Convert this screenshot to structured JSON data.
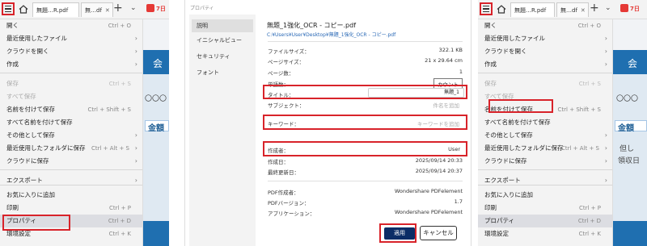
{
  "tabs": {
    "tab1_label": "無題…R.pdf",
    "tab2_label": "無…df",
    "close_glyph": "✕",
    "new_tab_glyph": "+",
    "more_glyph": "⌄",
    "promo_label": "7日"
  },
  "menu_left": [
    {
      "label": "開く",
      "shortcut": "Ctrl + O",
      "submenu": "",
      "disabled": false
    },
    {
      "label": "最近使用したファイル",
      "shortcut": "",
      "submenu": "›",
      "disabled": false
    },
    {
      "label": "クラウドを開く",
      "shortcut": "",
      "submenu": "›",
      "disabled": false
    },
    {
      "label": "作成",
      "shortcut": "",
      "submenu": "›",
      "disabled": false
    },
    {
      "label": "保存",
      "shortcut": "Ctrl + S",
      "submenu": "",
      "disabled": true
    },
    {
      "label": "すべて保存",
      "shortcut": "",
      "submenu": "",
      "disabled": true
    },
    {
      "label": "名前を付けて保存",
      "shortcut": "Ctrl + Shift + S",
      "submenu": "",
      "disabled": false
    },
    {
      "label": "すべて名前を付けて保存",
      "shortcut": "",
      "submenu": "",
      "disabled": false
    },
    {
      "label": "その他として保存",
      "shortcut": "",
      "submenu": "›",
      "disabled": false
    },
    {
      "label": "最近使用したフォルダに保存",
      "shortcut": "Ctrl + Alt + S",
      "submenu": "›",
      "disabled": false
    },
    {
      "label": "クラウドに保存",
      "shortcut": "",
      "submenu": "›",
      "disabled": false
    },
    {
      "label": "エクスポート",
      "shortcut": "",
      "submenu": "›",
      "disabled": false
    },
    {
      "label": "お気に入りに追加",
      "shortcut": "",
      "submenu": "",
      "disabled": false
    },
    {
      "label": "印刷",
      "shortcut": "Ctrl + P",
      "submenu": "",
      "disabled": false
    },
    {
      "label": "プロパティ",
      "shortcut": "Ctrl + D",
      "submenu": "",
      "disabled": false
    },
    {
      "label": "環境設定",
      "shortcut": "Ctrl + K",
      "submenu": "",
      "disabled": false
    }
  ],
  "menu_right": [
    {
      "label": "開く",
      "shortcut": "Ctrl + O",
      "submenu": "",
      "disabled": false
    },
    {
      "label": "最近使用したファイル",
      "shortcut": "",
      "submenu": "›",
      "disabled": false
    },
    {
      "label": "クラウドを開く",
      "shortcut": "",
      "submenu": "›",
      "disabled": false
    },
    {
      "label": "作成",
      "shortcut": "",
      "submenu": "›",
      "disabled": false
    },
    {
      "label": "保存",
      "shortcut": "Ctrl + S",
      "submenu": "",
      "disabled": true
    },
    {
      "label": "すべて保存",
      "shortcut": "",
      "submenu": "",
      "disabled": true
    },
    {
      "label": "名前を付けて保存",
      "shortcut": "Ctrl + Shift + S",
      "submenu": "",
      "disabled": false
    },
    {
      "label": "すべて名前を付けて保存",
      "shortcut": "",
      "submenu": "",
      "disabled": false
    },
    {
      "label": "その他として保存",
      "shortcut": "",
      "submenu": "›",
      "disabled": false
    },
    {
      "label": "最近使用したフォルダに保存",
      "shortcut": "Ctrl + Alt + S",
      "submenu": "›",
      "disabled": false
    },
    {
      "label": "クラウドに保存",
      "shortcut": "",
      "submenu": "›",
      "disabled": false
    },
    {
      "label": "エクスポート",
      "shortcut": "",
      "submenu": "›",
      "disabled": false
    },
    {
      "label": "お気に入りに追加",
      "shortcut": "",
      "submenu": "",
      "disabled": false
    },
    {
      "label": "印刷",
      "shortcut": "Ctrl + P",
      "submenu": "",
      "disabled": false
    },
    {
      "label": "プロパティ",
      "shortcut": "Ctrl + D",
      "submenu": "",
      "disabled": false
    },
    {
      "label": "環境設定",
      "shortcut": "Ctrl + K",
      "submenu": "",
      "disabled": false
    }
  ],
  "background_doc": {
    "right_header": "会",
    "left_header": "会",
    "circles": "〇〇〇",
    "amount_label": "金額",
    "note1": "但し",
    "note2": "領収日"
  },
  "dialog": {
    "title": "プロパティ",
    "sidebar": [
      "説明",
      "イニシャルビュー",
      "セキュリティ",
      "フォント"
    ],
    "file_name": "無題_1強化_OCR - コピー.pdf",
    "file_path": "C:¥Users¥User¥Desktop¥無題_1強化_OCR - コピー.pdf",
    "file_size_label": "ファイルサイズ：",
    "file_size_value": "322.1 KB",
    "page_size_label": "ページサイズ：",
    "page_size_value": "21 x 29.64 cm",
    "page_count_label": "ページ数：",
    "page_count_value": "1",
    "word_count_label": "単語数：",
    "count_button": "カウント",
    "title_label": "タイトル：",
    "title_value": "無題_1",
    "subject_label": "サブジェクト：",
    "subject_placeholder": "件名を追加",
    "keyword_label": "キーワード：",
    "keyword_placeholder": "キーワードを追加",
    "author_label": "作成者：",
    "author_value": "User",
    "created_label": "作成日：",
    "created_value": "2025/09/14 20:33",
    "modified_label": "最終更新日：",
    "modified_value": "2025/09/14 20:37",
    "producer_label": "PDF作成者：",
    "producer_value": "Wondershare PDFelement",
    "version_label": "PDFバージョン：",
    "version_value": "1.7",
    "app_label": "アプリケーション：",
    "app_value": "Wondershare PDFelement",
    "apply_button": "適用",
    "cancel_button": "キャンセル"
  },
  "highlight_color": "#d8232a"
}
